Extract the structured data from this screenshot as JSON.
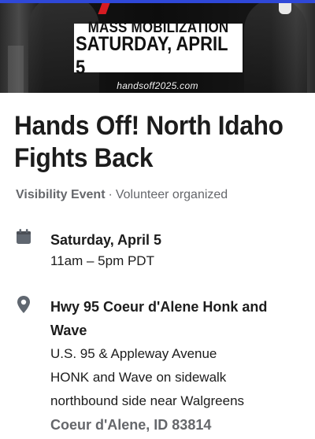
{
  "banner": {
    "headline_1": "MASS MOBILIZATION",
    "headline_2": "SATURDAY, APRIL 5",
    "url": "handsoff2025.com"
  },
  "event": {
    "title": "Hands Off! North Idaho Fights Back",
    "type": "Visibility Event",
    "separator": "·",
    "organizer": "Volunteer organized"
  },
  "date": {
    "icon": "calendar-icon",
    "day": "Saturday, April 5",
    "time": "11am – 5pm PDT"
  },
  "location": {
    "icon": "location-pin-icon",
    "name": "Hwy 95 Coeur d'Alene Honk and Wave",
    "address_1": "U.S. 95 & Appleway Avenue",
    "address_2": "HONK and Wave on sidewalk",
    "address_3": "northbound side near Walgreens",
    "city": "Coeur d'Alene, ID 83814"
  },
  "colors": {
    "top_bar": "#2f48d8",
    "text": "#1c1c1c",
    "secondary_text": "#65676b",
    "icon": "#606770"
  }
}
